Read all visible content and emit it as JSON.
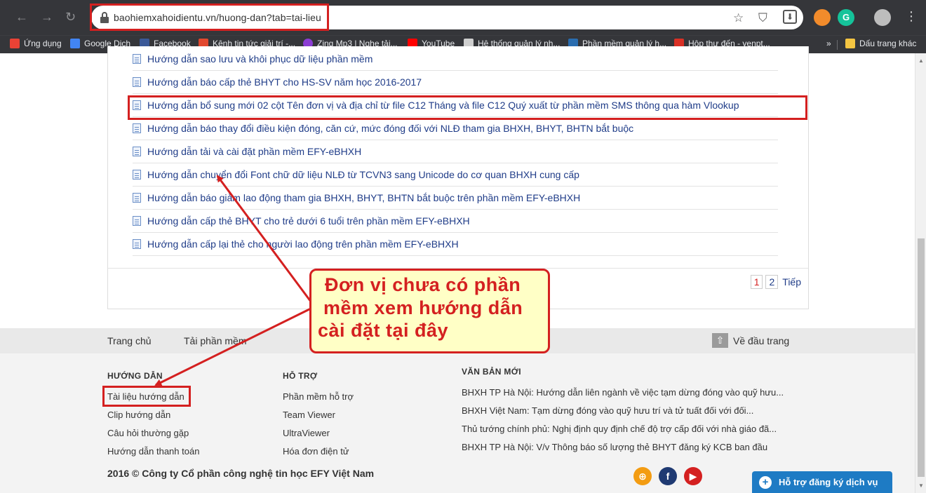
{
  "browser": {
    "url": "baohiemxahoidientu.vn/huong-dan?tab=tai-lieu",
    "bookmarks": [
      {
        "label": "Ứng dụng",
        "color": "#e94235"
      },
      {
        "label": "Google Dịch",
        "color": "#4285f4"
      },
      {
        "label": "Facebook",
        "color": "#3b5998"
      },
      {
        "label": "Kênh tin tức giải trí -...",
        "color": "#e2482e"
      },
      {
        "label": "Zing Mp3 | Nghe tải...",
        "color": "#8b3dd3"
      },
      {
        "label": "YouTube",
        "color": "#ff0000"
      },
      {
        "label": "Hệ thống quản lý nh...",
        "color": "#cfcfcf"
      },
      {
        "label": "Phần mềm quản lý h...",
        "color": "#2a6db0"
      },
      {
        "label": "Hộp thư đến - yenpt...",
        "color": "#d93025"
      }
    ],
    "bookmarks_more": "»",
    "other_bookmarks": "Dấu trang khác"
  },
  "documents": [
    "Hướng dẫn sao lưu và khôi phục dữ liệu phần mềm",
    "Hướng dẫn báo cấp thẻ BHYT cho HS-SV năm học 2016-2017",
    "Hướng dẫn bổ sung mới 02 cột Tên đơn vị và địa chỉ từ file C12 Tháng và file C12 Quý xuất từ phần mềm SMS thông qua hàm Vlookup",
    "Hướng dẫn báo thay đổi điều kiện đóng, căn cứ, mức đóng đối với NLĐ tham gia BHXH, BHYT, BHTN bắt buộc",
    "Hướng dẫn tải và cài đặt phần mềm EFY-eBHXH",
    "Hướng dẫn chuyển đổi Font chữ dữ liệu NLĐ từ TCVN3 sang Unicode do cơ quan BHXH cung cấp",
    "Hướng dẫn báo giảm lao động tham gia BHXH, BHYT, BHTN bắt buộc trên phần mềm EFY-eBHXH",
    "Hướng dẫn cấp thẻ BHYT cho trẻ dưới 6 tuổi trên phần mềm EFY-eBHXH",
    "Hướng dẫn cấp lại thẻ cho người lao động trên phần mềm EFY-eBHXH"
  ],
  "pagination": {
    "pages": [
      "1",
      "2"
    ],
    "current": "1",
    "next": "Tiếp"
  },
  "footer_nav": {
    "home": "Trang chủ",
    "download": "Tải phần mềm",
    "to_top": "Về đầu trang"
  },
  "footer": {
    "guide": {
      "heading": "HƯỚNG DẪN",
      "links": [
        "Tài liệu hướng dẫn",
        "Clip hướng dẫn",
        "Câu hỏi thường gặp",
        "Hướng dẫn thanh toán"
      ]
    },
    "support": {
      "heading": "HỖ TRỢ",
      "links": [
        "Phần mềm hỗ trợ",
        "Team Viewer",
        "UltraViewer",
        "Hóa đơn điện tử"
      ]
    },
    "news": {
      "heading": "VĂN BẢN MỚI",
      "links": [
        "BHXH TP Hà Nội: Hướng dẫn liên ngành về việc tạm dừng đóng vào quỹ hưu...",
        "BHXH Việt Nam: Tạm dừng đóng vào quỹ hưu trí và tử tuất đối với đối...",
        "Thủ tướng chính phủ: Nghị định quy định chế độ trợ cấp đối với nhà giáo đã...",
        "BHXH TP Hà Nội: V/v Thông báo số lượng thẻ BHYT đăng ký KCB ban đầu"
      ]
    },
    "copyright": "2016 © Công ty Cổ phần công nghệ tin học EFY Việt Nam",
    "support_button": "Hỗ trợ đăng ký dịch vụ"
  },
  "callout": {
    "lines": [
      "Đơn vị chưa có phần",
      "mềm xem hướng dẫn",
      "cài đặt tại đây"
    ]
  },
  "colors": {
    "highlight_red": "#d42020",
    "link_blue": "#1f3c88",
    "callout_bg": "#ffffc6",
    "support_blue": "#1e7bc4"
  }
}
